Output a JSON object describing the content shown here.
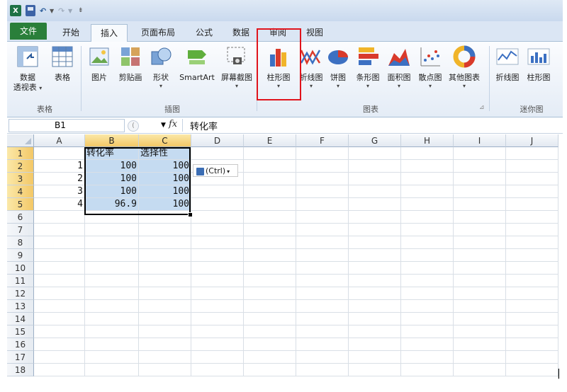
{
  "title_bar": {
    "app_logo": "X"
  },
  "tabs": [
    {
      "label": "文件"
    },
    {
      "label": "开始"
    },
    {
      "label": "插入"
    },
    {
      "label": "页面布局"
    },
    {
      "label": "公式"
    },
    {
      "label": "数据"
    },
    {
      "label": "审阅"
    },
    {
      "label": "视图"
    }
  ],
  "ribbon": {
    "pivot": {
      "label1": "数据",
      "label2": "透视表"
    },
    "table": "表格",
    "picture": "图片",
    "clipart": "剪贴画",
    "shapes": "形状",
    "smartart": "SmartArt",
    "screenshot": "屏幕截图",
    "column_chart": "柱形图",
    "line_chart": "折线图",
    "pie_chart": "饼图",
    "bar_chart": "条形图",
    "area_chart": "面积图",
    "scatter_chart": "散点图",
    "other_charts": "其他图表",
    "spark_line": "折线图",
    "spark_column": "柱形图",
    "groups": {
      "tables": "表格",
      "illustrations": "插图",
      "charts": "图表",
      "sparklines": "迷你图"
    }
  },
  "formula_bar": {
    "name_box": "B1",
    "fx": "fx",
    "content": "转化率"
  },
  "columns": [
    "A",
    "B",
    "C",
    "D",
    "E",
    "F",
    "G",
    "H",
    "I",
    "J"
  ],
  "rows": [
    "1",
    "2",
    "3",
    "4",
    "5",
    "6",
    "7",
    "8",
    "9",
    "10",
    "11",
    "12",
    "13",
    "14",
    "15",
    "16",
    "17",
    "18"
  ],
  "cells": {
    "B1": "转化率",
    "C1": "选择性",
    "A2": "1",
    "B2": "100",
    "C2": "100",
    "A3": "2",
    "B3": "100",
    "C3": "100",
    "A4": "3",
    "B4": "100",
    "C4": "100",
    "A5": "4",
    "B5": "96.9",
    "C5": "100"
  },
  "paste_options": "(Ctrl)",
  "colors": {
    "file_tab": "#2a7f3a",
    "highlight": "#e0141c",
    "selection": "#c5dbf1"
  }
}
